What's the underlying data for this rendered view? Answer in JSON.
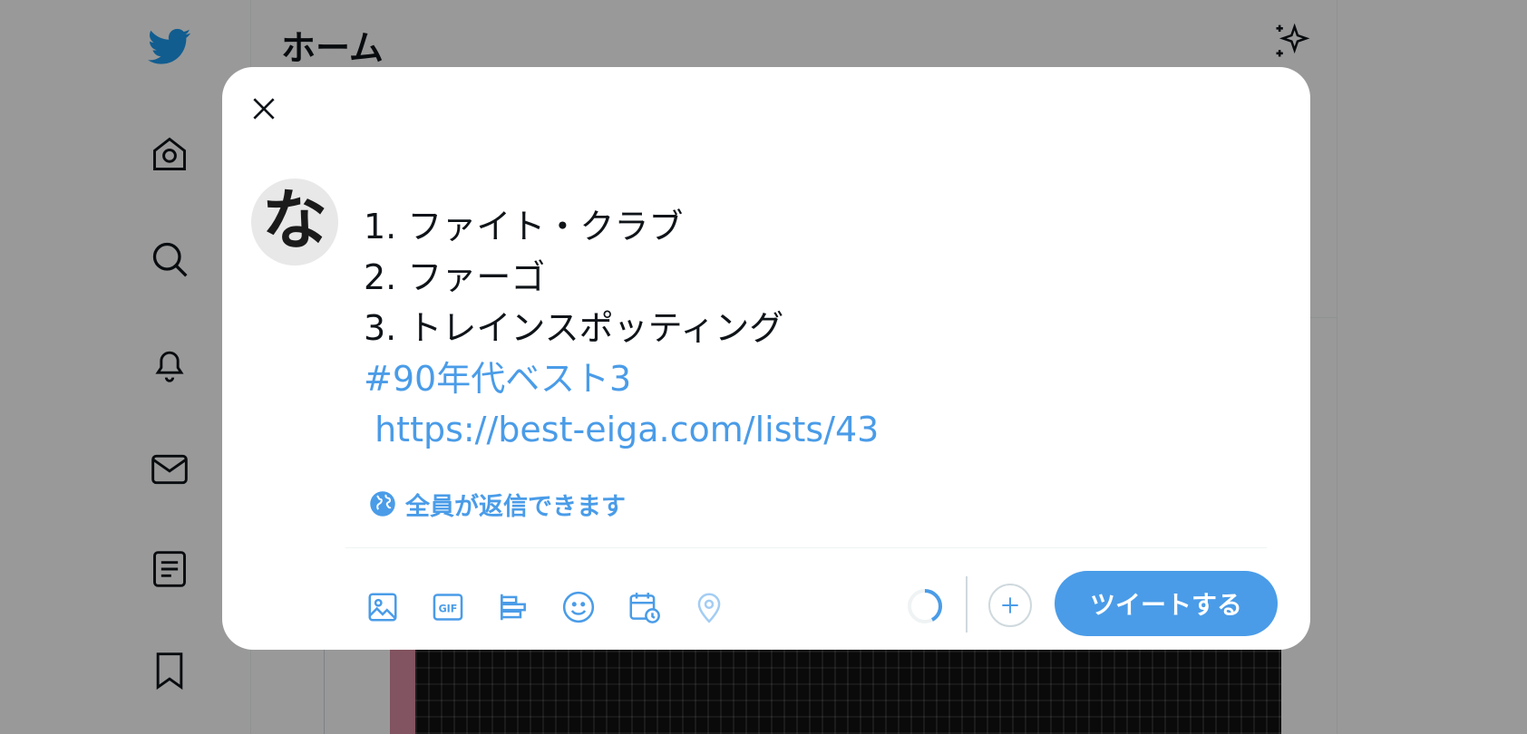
{
  "header": {
    "title": "ホーム"
  },
  "left_nav": {
    "items": [
      {
        "icon": "twitter-logo-icon"
      },
      {
        "icon": "home-icon"
      },
      {
        "icon": "search-icon"
      },
      {
        "icon": "bell-icon"
      },
      {
        "icon": "mail-icon"
      },
      {
        "icon": "lists-icon"
      },
      {
        "icon": "bookmark-icon"
      }
    ]
  },
  "composer": {
    "avatar_text": "な",
    "lines": [
      "1. ファイト・クラブ",
      "2. ファーゴ",
      "3. トレインスポッティング",
      "#90年代ベスト3",
      " https://best-eiga.com/lists/43"
    ],
    "reply_setting": "全員が返信できます",
    "tweet_button": "ツイートする"
  },
  "toolbar": {
    "icons": [
      "image-icon",
      "gif-icon",
      "poll-icon",
      "emoji-icon",
      "schedule-icon",
      "location-icon"
    ]
  },
  "colors": {
    "accent": "#4a9ce8",
    "brand": "#1d9bf0",
    "text": "#0f1419"
  }
}
